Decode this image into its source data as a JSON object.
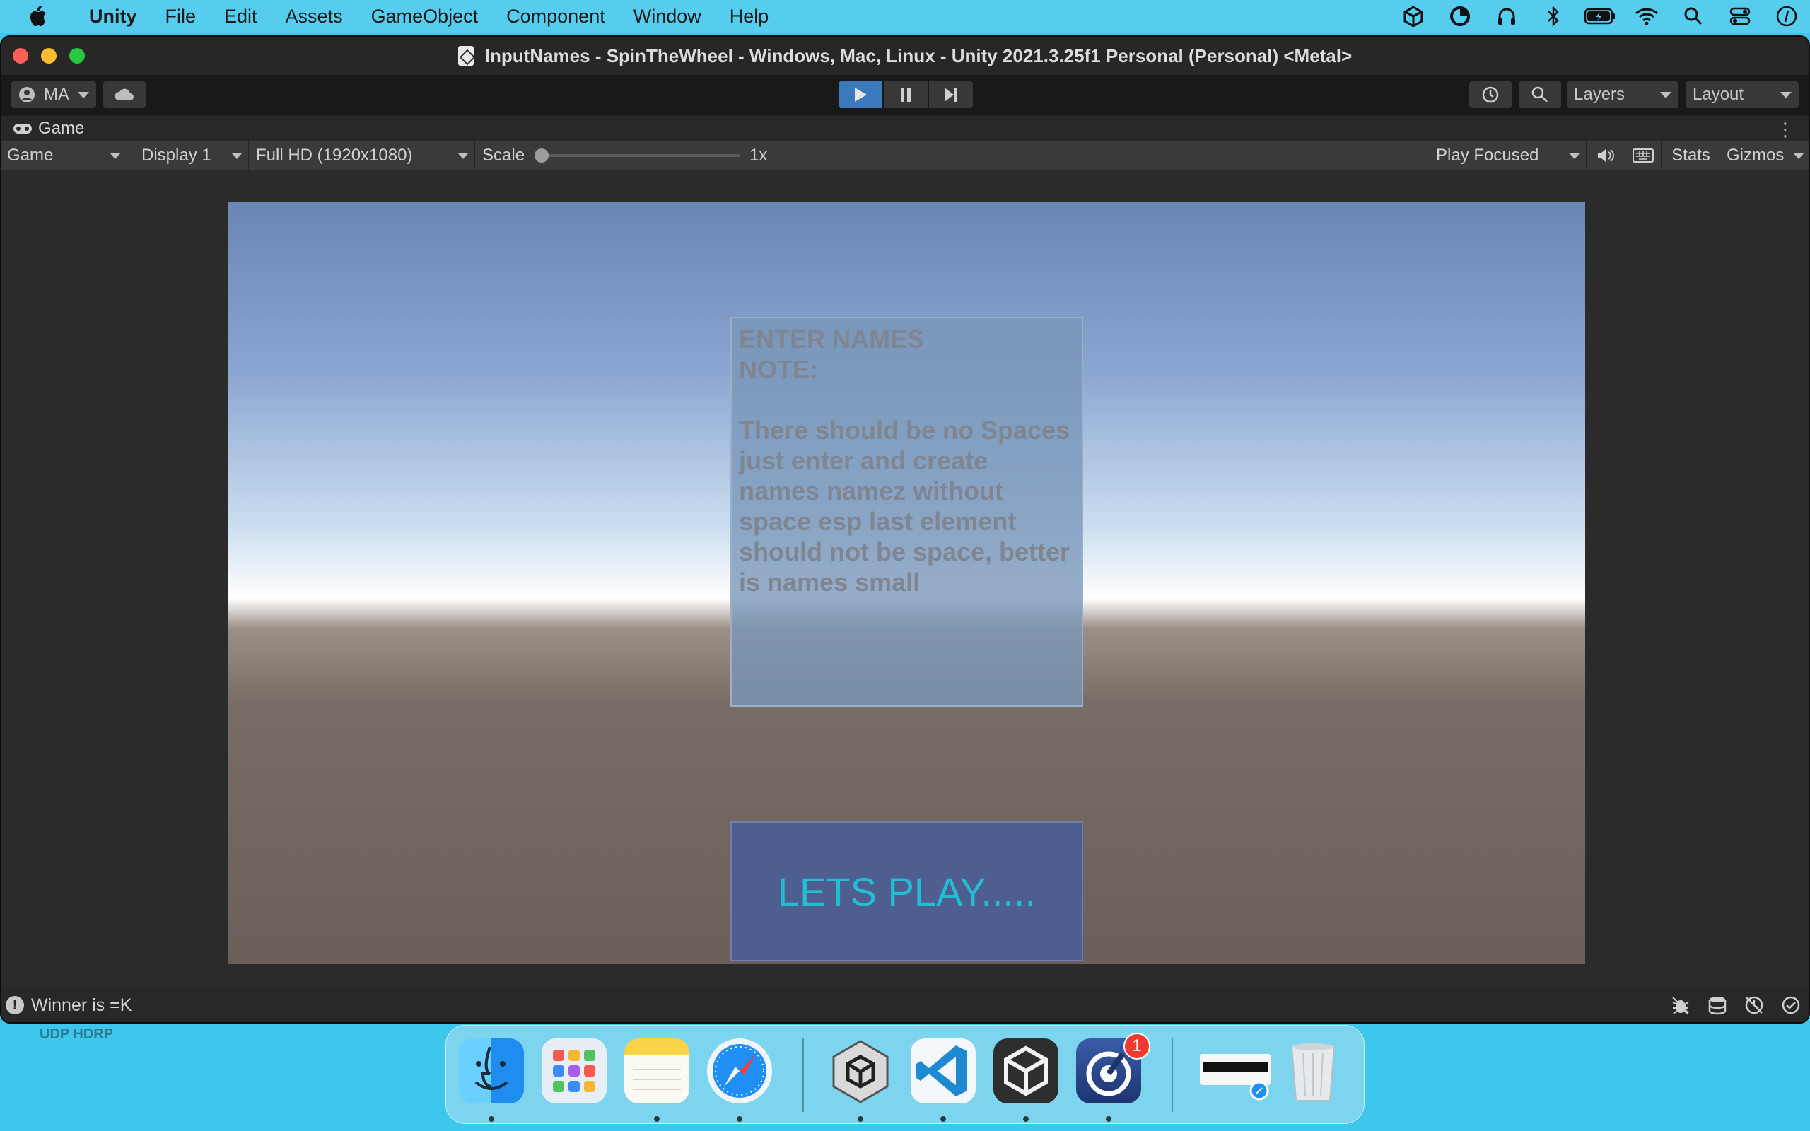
{
  "menubar": {
    "app_name": "Unity",
    "items": [
      "File",
      "Edit",
      "Assets",
      "GameObject",
      "Component",
      "Window",
      "Help"
    ],
    "status_icons": [
      "unity-hub-icon",
      "creative-cloud-icon",
      "headphones-icon",
      "bluetooth-icon",
      "battery-icon",
      "wifi-icon",
      "spotlight-search-icon",
      "control-center-icon",
      "siri-icon"
    ]
  },
  "window": {
    "title": "InputNames - SpinTheWheel - Windows, Mac, Linux - Unity 2021.3.25f1 Personal (Personal) <Metal>"
  },
  "toolbar": {
    "account_label": "MA",
    "layers_label": "Layers",
    "layout_label": "Layout",
    "play_accent": "#3a79bb"
  },
  "tab": {
    "label": "Game"
  },
  "gamebar": {
    "view_mode": "Game",
    "display": "Display 1",
    "resolution": "Full HD (1920x1080)",
    "scale_label": "Scale",
    "scale_value": "1x",
    "scale_fraction": 0.0,
    "play_mode": "Play Focused",
    "stats_label": "Stats",
    "gizmos_label": "Gizmos"
  },
  "game": {
    "panel_title": "ENTER NAMES",
    "note_label": "NOTE:",
    "note_text": "There should be no Spaces just enter and create names namez without space esp last element should not be space, better is names small",
    "play_button": "LETS PLAY.....",
    "play_button_color": "#22bfd3"
  },
  "status": {
    "message": "Winner is =K"
  },
  "desktop": {
    "label": "UDP HDRP"
  },
  "dock": {
    "apps": [
      "Finder",
      "Launchpad",
      "Notes",
      "Safari",
      "Unity Hub",
      "Visual Studio Code",
      "Unity",
      "Focus",
      "Safari Window",
      "Trash"
    ],
    "focus_badge": "1"
  }
}
